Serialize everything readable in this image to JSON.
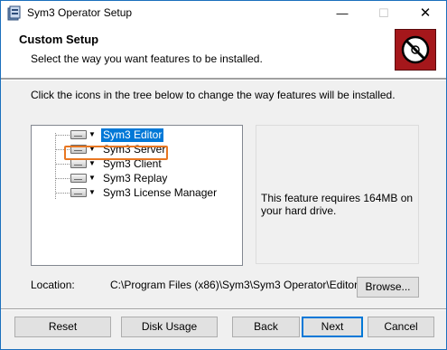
{
  "window": {
    "title": "Sym3 Operator Setup"
  },
  "titlebar": {
    "minimize_glyph": "—",
    "maximize_glyph": "☐",
    "close_glyph": "✕"
  },
  "banner": {
    "title": "Custom Setup",
    "subtitle": "Select the way you want features to be installed.",
    "logo_icon": "no-entry-disc-icon",
    "logo_color": "#a5171b"
  },
  "instructions": "Click the icons in the tree below to change the way features will be installed.",
  "tree": {
    "items": [
      {
        "label": "Sym3 Editor",
        "selected": true,
        "icon": "drive-icon"
      },
      {
        "label": "Sym3 Server",
        "selected": false,
        "icon": "drive-icon"
      },
      {
        "label": "Sym3 Client",
        "selected": false,
        "icon": "drive-icon"
      },
      {
        "label": "Sym3 Replay",
        "selected": false,
        "icon": "drive-icon"
      },
      {
        "label": "Sym3 License Manager",
        "selected": false,
        "icon": "drive-icon"
      }
    ],
    "dropdown_glyph": "▼"
  },
  "description": "This feature requires 164MB on your hard drive.",
  "location": {
    "label": "Location:",
    "path": "C:\\Program Files (x86)\\Sym3\\Sym3 Operator\\Editor\\",
    "browse_label": "Browse..."
  },
  "footer": {
    "reset_label": "Reset",
    "disk_usage_label": "Disk Usage",
    "back_label": "Back",
    "next_label": "Next",
    "cancel_label": "Cancel"
  },
  "colors": {
    "selection": "#0078d7",
    "highlight_border": "#e87722",
    "accent_border": "#1b6fbd"
  }
}
